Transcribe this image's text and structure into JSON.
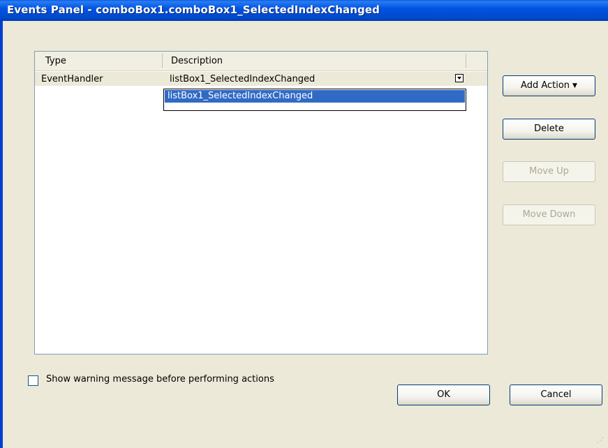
{
  "window": {
    "title": "Events Panel - comboBox1.comboBox1_SelectedIndexChanged"
  },
  "grid": {
    "columns": [
      "Type",
      "Description"
    ],
    "rows": [
      {
        "type": "EventHandler",
        "description": "listBox1_SelectedIndexChanged"
      }
    ],
    "dropdown_options": [
      "listBox1_SelectedIndexChanged"
    ]
  },
  "actions": {
    "add_action": "Add Action",
    "delete": "Delete",
    "move_up": "Move Up",
    "move_down": "Move Down"
  },
  "options": {
    "show_warning_label": "Show warning message before performing actions",
    "show_warning_checked": false
  },
  "footer": {
    "ok": "OK",
    "cancel": "Cancel"
  },
  "colors": {
    "titlebar": "#0054e3",
    "selection": "#316ac5",
    "dialog_bg": "#ece9d8"
  },
  "icons": [
    "dropdown-arrow-icon",
    "chevron-down-icon",
    "resize-grip-icon"
  ]
}
